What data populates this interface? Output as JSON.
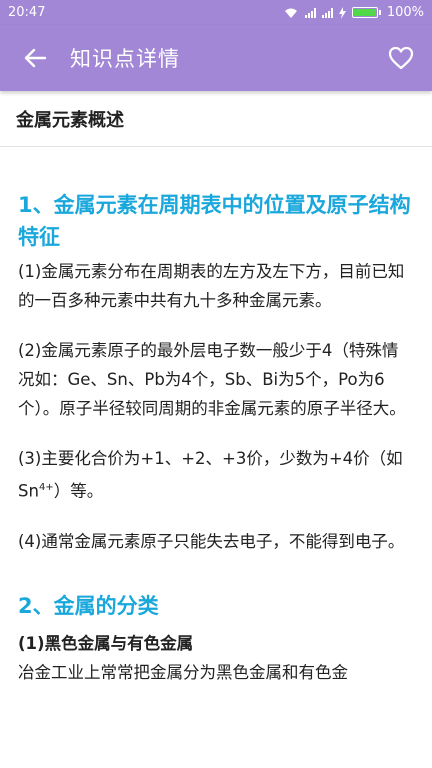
{
  "status": {
    "time": "20:47",
    "battery": "100%"
  },
  "appbar": {
    "title": "知识点详情"
  },
  "header": {
    "title": "金属元素概述"
  },
  "sections": [
    {
      "title": "1、金属元素在周期表中的位置及原子结构特征"
    },
    {
      "title": "2、金属的分类"
    }
  ],
  "paragraphs": [
    "(1)金属元素分布在周期表的左方及左下方，目前已知的一百多种元素中共有九十多种金属元素。",
    "(2)金属元素原子的最外层电子数一般少于4（特殊情况如：Ge、Sn、Pb为4个，Sb、Bi为5个，Po为6个）。原子半径较同周期的非金属元素的原子半径大。",
    "(3)主要化合价为+1、+2、+3价，少数为+4价（如Sn",
    "4+",
    "）等。",
    "(4)通常金属元素原子只能失去电子，不能得到电子。",
    "(1)黑色金属与有色金属",
    "冶金工业上常常把金属分为黑色金属和有色金"
  ],
  "icons": {
    "back": "arrow-left-icon",
    "favorite": "heart-outline-icon"
  },
  "colors": {
    "bar": "#a287d6",
    "accent": "#1aa8dc"
  }
}
